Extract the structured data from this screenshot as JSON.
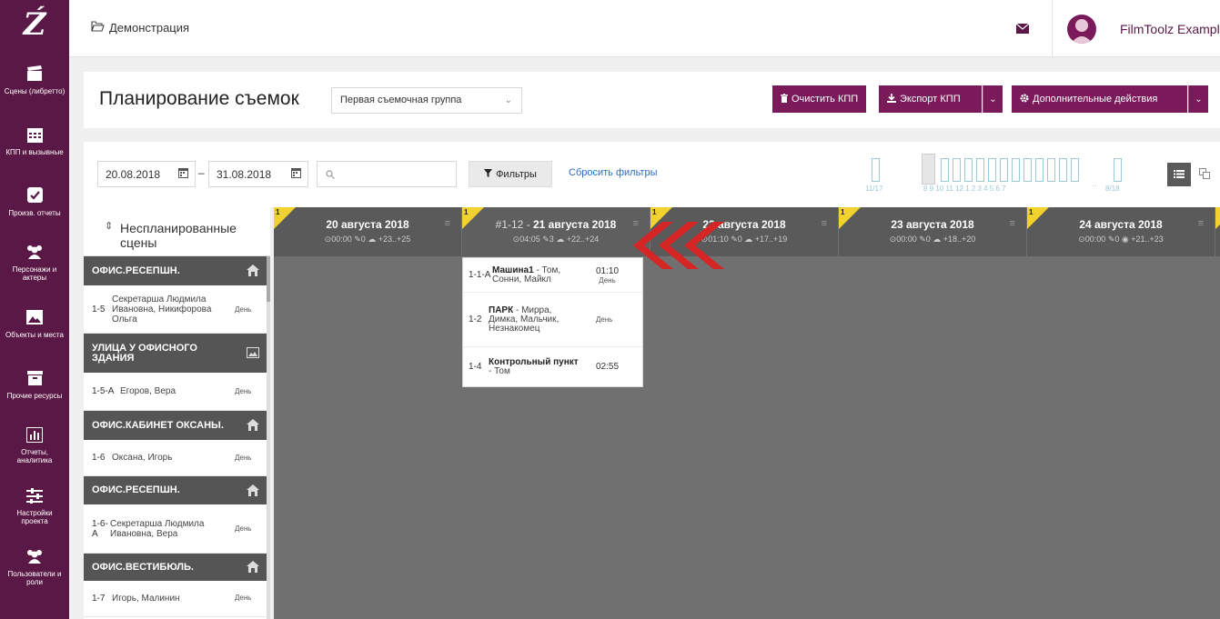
{
  "colors": {
    "brand": "#5a1846",
    "button": "#7a1a5a",
    "set_header": "#555555",
    "day_flag": "#f2d22e",
    "link": "#2a6dbf",
    "timeline": "#9bc9d8",
    "arrow": "#d62525"
  },
  "sidebar": {
    "logo": "Ź",
    "items": [
      {
        "icon": "clapperboard-icon",
        "label": "Сцены (либретто)"
      },
      {
        "icon": "calendar-grid-icon",
        "label": "КПП и вызывные"
      },
      {
        "icon": "check-square-icon",
        "label": "Произв. отчеты"
      },
      {
        "icon": "people-icon",
        "label": "Персонажи и актеры"
      },
      {
        "icon": "image-icon",
        "label": "Объекты и места"
      },
      {
        "icon": "archive-icon",
        "label": "Прочие ресурсы"
      },
      {
        "icon": "bar-chart-icon",
        "label": "Отчеты, аналитика"
      },
      {
        "icon": "sliders-icon",
        "label": "Настройки проекта"
      },
      {
        "icon": "users-icon",
        "label": "Пользователи и роли"
      }
    ]
  },
  "topbar": {
    "breadcrumb": "Демонстрация",
    "username": "FilmToolz Example"
  },
  "header": {
    "title": "Планирование съемок",
    "group_select": "Первая съемочная группа",
    "clear_btn": "Очистить КПП",
    "export_btn": "Экспорт КПП",
    "more_btn": "Дополнительные действия"
  },
  "filters": {
    "date_from": "20.08.2018",
    "date_to": "31.08.2018",
    "dash": "–",
    "search_placeholder": "",
    "filters_btn": "Фильтры",
    "reset_link": "Сбросить фильтры",
    "timeline_labels": {
      "start": "11/17",
      "days": "8 9 10 11 12 1 2 3 4 5 6 7",
      "dots": "...",
      "end": "8/18"
    }
  },
  "scenes_panel": {
    "title_line1": "Неспланированные",
    "title_line2": "сцены",
    "sort_icon": "sort-icon",
    "groups": [
      {
        "set": "ОФИС.РЕСЕПШН.",
        "icon": "home-icon",
        "scenes": [
          {
            "num": "1-5",
            "desc": "Секретарша Людмила Ивановна, Никифорова Ольга",
            "time": "День"
          }
        ]
      },
      {
        "set": "УЛИЦА У ОФИСНОГО ЗДАНИЯ",
        "icon": "image-icon",
        "scenes": [
          {
            "num": "1-5-А",
            "desc": "Егоров, Вера",
            "time": "День"
          }
        ]
      },
      {
        "set": "ОФИС.КАБИНЕТ ОКСАНЫ.",
        "icon": "home-icon",
        "scenes": [
          {
            "num": "1-6",
            "desc": "Оксана, Игорь",
            "time": "День"
          }
        ]
      },
      {
        "set": "ОФИС.РЕСЕПШН.",
        "icon": "home-icon",
        "scenes": [
          {
            "num": "1-6-А",
            "desc": "Секретарша Людмила Ивановна, Вера",
            "time": "День"
          }
        ]
      },
      {
        "set": "ОФИС.ВЕСТИБЮЛЬ.",
        "icon": "home-icon",
        "scenes": [
          {
            "num": "1-7",
            "desc": "Игорь, Малинин",
            "time": "День"
          }
        ]
      }
    ]
  },
  "days": [
    {
      "flag": "1",
      "prefix": "",
      "title": "20 августа 2018",
      "meta": "⊙00:00 ✎0 ☁ +23..+25"
    },
    {
      "flag": "1",
      "prefix": "#1-12 - ",
      "title": "21 августа 2018",
      "meta": "⊙04:05 ✎3 ☁ +22..+24"
    },
    {
      "flag": "1",
      "prefix": "",
      "title": "22 августа 2018",
      "meta": "⊙01:10 ✎0 ☁ +17..+19"
    },
    {
      "flag": "1",
      "prefix": "",
      "title": "23 августа 2018",
      "meta": "⊙00:00 ✎0 ☁ +18..+20"
    },
    {
      "flag": "1",
      "prefix": "",
      "title": "24 августа 2018",
      "meta": "⊙00:00 ✎0 ◉ +21..+23"
    }
  ],
  "day_card": {
    "rows": [
      {
        "num": "1-1-А",
        "title": "Машина1",
        "people": " - Том, Сонни, Майкл",
        "time": "01:10",
        "daypart": "День"
      },
      {
        "num": "1-2",
        "title": "ПАРК",
        "people": " - Мирра, Димка, Мальчик, Незнакомец",
        "time": "",
        "daypart": "День"
      },
      {
        "num": "1-4",
        "title": "Контрольный пункт",
        "people": " - Том",
        "time": "02:55",
        "daypart": ""
      }
    ]
  }
}
